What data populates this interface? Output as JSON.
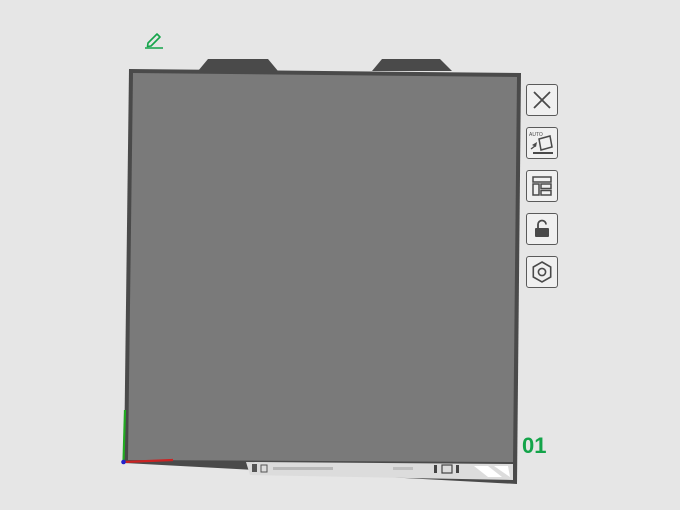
{
  "plate": {
    "number": "01",
    "accent_color": "#14a44a",
    "surface_color": "#7a7a7a",
    "frame_color": "#4a4a4a"
  },
  "toolbar": {
    "buttons": [
      {
        "name": "close-plate-button",
        "icon": "close-icon"
      },
      {
        "name": "auto-orient-button",
        "icon": "auto-orient-icon",
        "label": "AUTO"
      },
      {
        "name": "arrange-button",
        "icon": "arrange-icon"
      },
      {
        "name": "lock-button",
        "icon": "unlock-icon"
      },
      {
        "name": "plate-settings-button",
        "icon": "hexagon-nut-icon"
      }
    ]
  },
  "edit": {
    "icon": "pencil-icon"
  },
  "axes": {
    "x_color": "#cc2222",
    "y_color": "#22aa22",
    "z_color": "#2222cc"
  }
}
